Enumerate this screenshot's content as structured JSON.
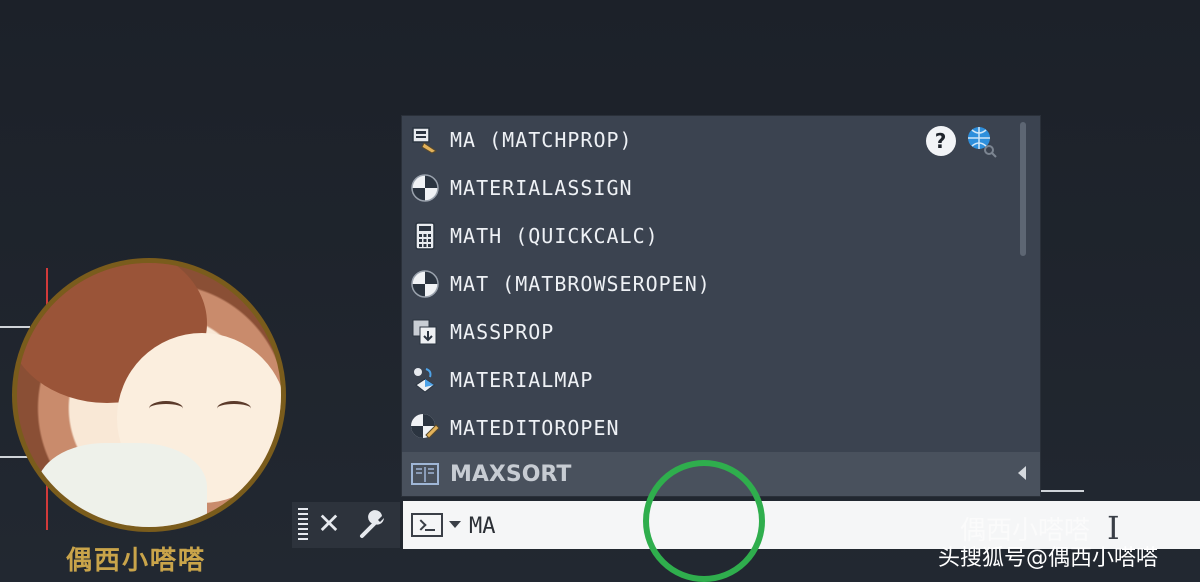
{
  "autocomplete": {
    "items": [
      {
        "label": "MA (MATCHPROP)",
        "icon": "matchprop-icon"
      },
      {
        "label": "MATERIALASSIGN",
        "icon": "material-ball-icon"
      },
      {
        "label": "MATH (QUICKCALC)",
        "icon": "calculator-icon"
      },
      {
        "label": "MAT (MATBROWSEROPEN)",
        "icon": "material-ball-icon"
      },
      {
        "label": "MASSPROP",
        "icon": "massprop-icon"
      },
      {
        "label": "MATERIALMAP",
        "icon": "materialmap-icon"
      },
      {
        "label": "MATEDITOROPEN",
        "icon": "material-editor-icon"
      }
    ],
    "footer_label": "MAXSORT",
    "help_icon_text": "?"
  },
  "command_line": {
    "input_value": "MA",
    "close_symbol": "✕"
  },
  "avatar": {
    "caption": "偶西小嗒嗒"
  },
  "watermark": {
    "main": "头搜狐号@偶西小嗒嗒",
    "faint": "偶西小嗒嗒"
  },
  "colors": {
    "popup_bg": "#3b4350",
    "footer_bg": "#49515d",
    "highlight_ring": "#2fae4d"
  }
}
